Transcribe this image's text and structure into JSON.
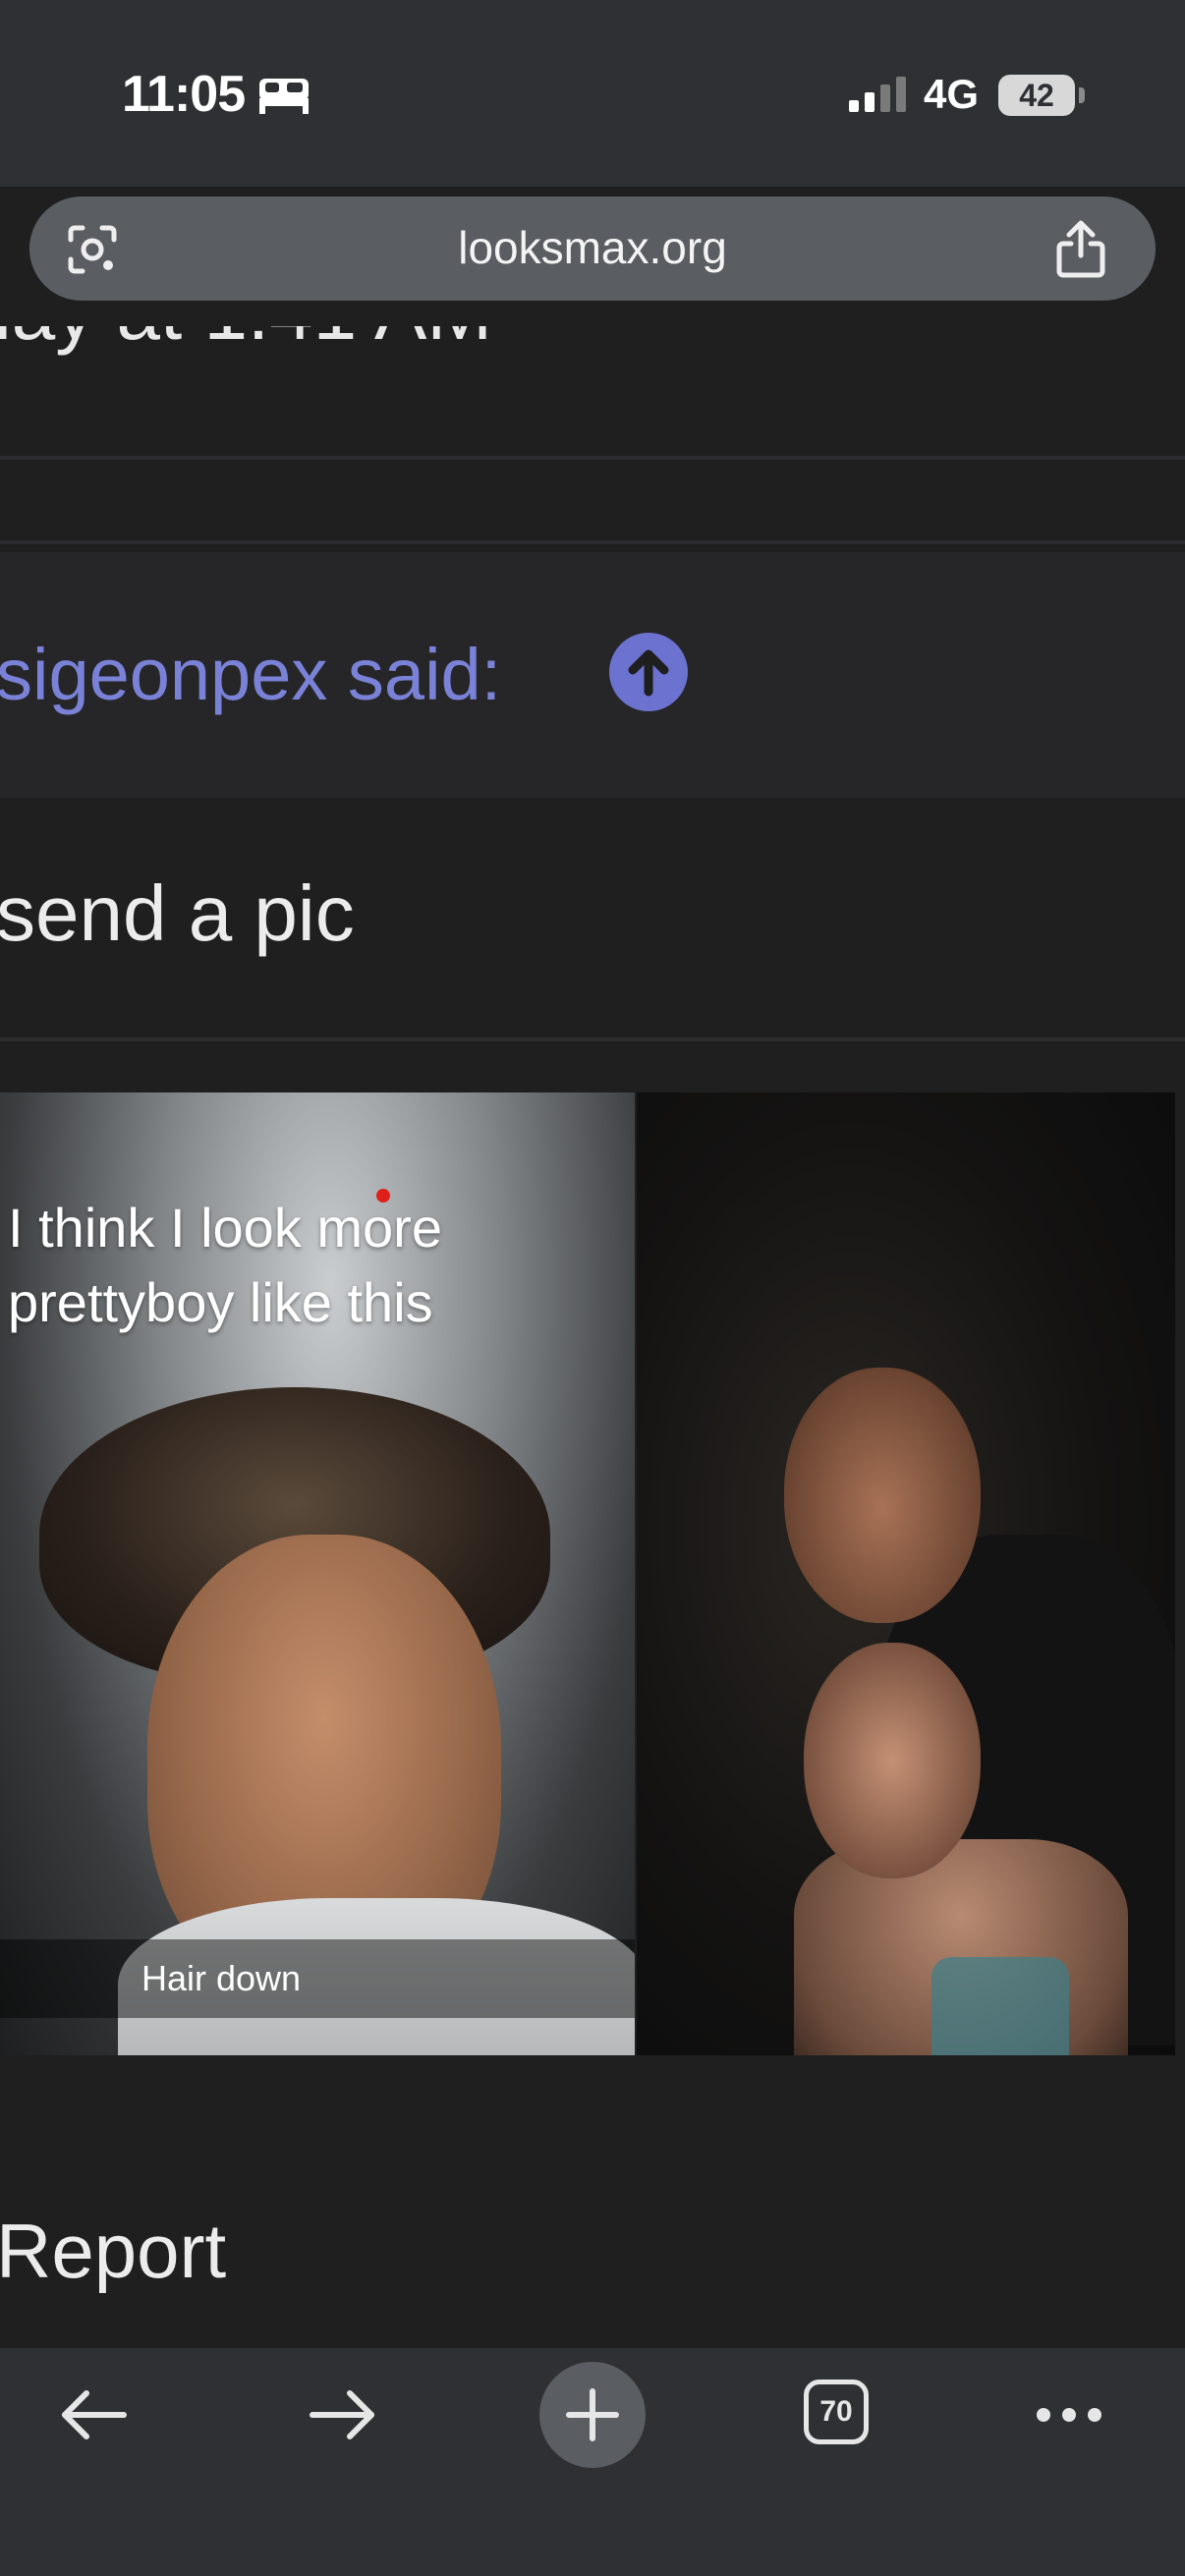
{
  "status_bar": {
    "time": "11:05",
    "network": "4G",
    "battery": "42"
  },
  "address_bar": {
    "url": "looksmax.org"
  },
  "post": {
    "date_line": "lay at 1:41 AM",
    "quote_author": "sigeonpex said:",
    "quote_text": "send a pic",
    "photo1": {
      "caption_top": "I think I look more prettyboy like this",
      "caption_bottom": "Hair down"
    },
    "report_label": "Report"
  },
  "toolbar": {
    "tab_count": "70"
  },
  "colors": {
    "link": "#7a82d8",
    "background": "#1f1f20",
    "chrome": "#2e3033"
  }
}
